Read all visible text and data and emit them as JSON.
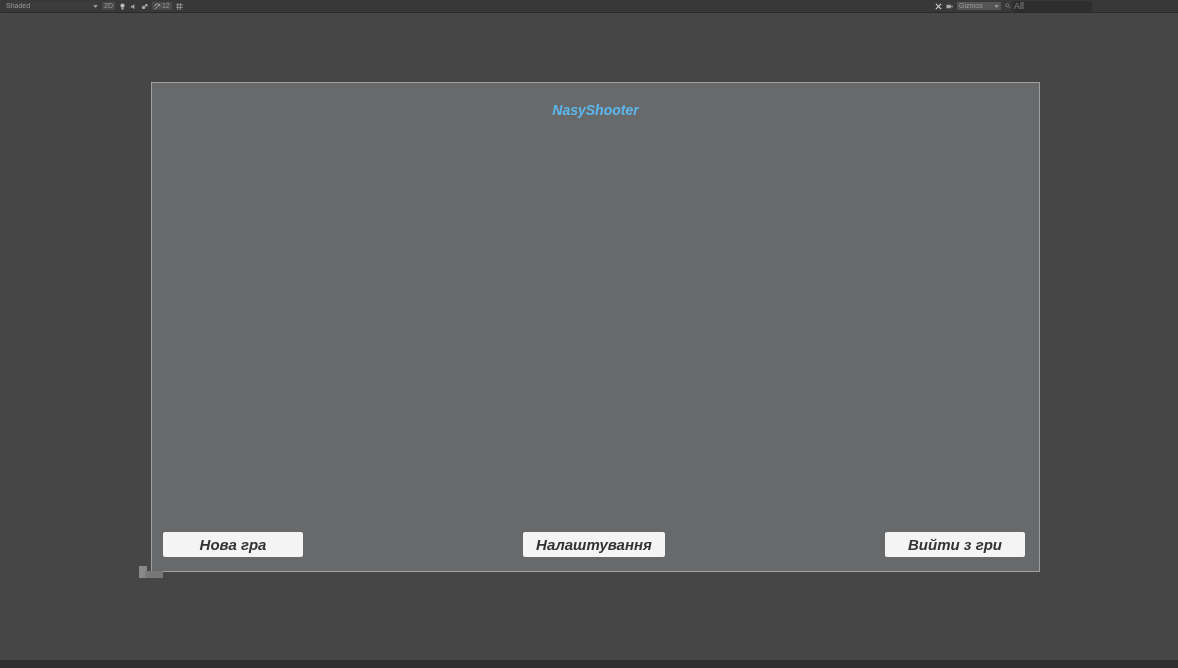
{
  "toolbar": {
    "draw_mode": "Shaded",
    "mode_2d": "2D",
    "effects_count": "12",
    "gizmos": "Gizmos",
    "search": {
      "placeholder": "All"
    }
  },
  "canvas": {
    "title": "NasyShooter",
    "buttons": [
      {
        "label": "Нова гра"
      },
      {
        "label": "Налаштування"
      },
      {
        "label": "Вийти з гри"
      }
    ]
  }
}
